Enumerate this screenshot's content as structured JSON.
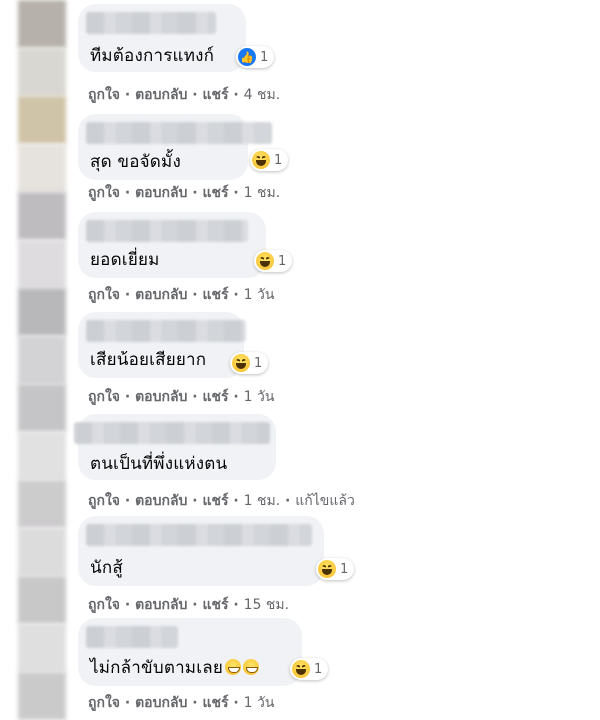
{
  "actions": {
    "like": "ถูกใจ",
    "reply": "ตอบกลับ",
    "share": "แชร์"
  },
  "separator": "·",
  "comments": [
    {
      "text": "ทีมต้องการแทงก์",
      "reaction": "like-icon",
      "count": "1",
      "time": "4 ชม.",
      "edited": ""
    },
    {
      "text": "สุด ขอจัดมั้ง",
      "reaction": "haha-icon",
      "count": "1",
      "time": "1 ชม.",
      "edited": ""
    },
    {
      "text": "ยอดเยี่ยม",
      "reaction": "haha-icon",
      "count": "1",
      "time": "1 วัน",
      "edited": ""
    },
    {
      "text": "เสียน้อยเสียยาก",
      "reaction": "haha-icon",
      "count": "1",
      "time": "1 วัน",
      "edited": ""
    },
    {
      "text": "ตนเป็นที่พึ่งแห่งตน",
      "reaction": "",
      "count": "",
      "time": "1 ชม.",
      "edited": "แก้ไขแล้ว"
    },
    {
      "text": "นักสู้",
      "reaction": "haha-icon",
      "count": "1",
      "time": "15 ชม.",
      "edited": ""
    },
    {
      "text": "ไม่กล้าขับตามเลย",
      "reaction": "haha-icon",
      "count": "1",
      "time": "1 วัน",
      "edited": ""
    }
  ],
  "colors": {
    "bubble": "#f0f2f5",
    "meta": "#65676b",
    "like": "#1877f2",
    "haha": "#f7b928"
  }
}
